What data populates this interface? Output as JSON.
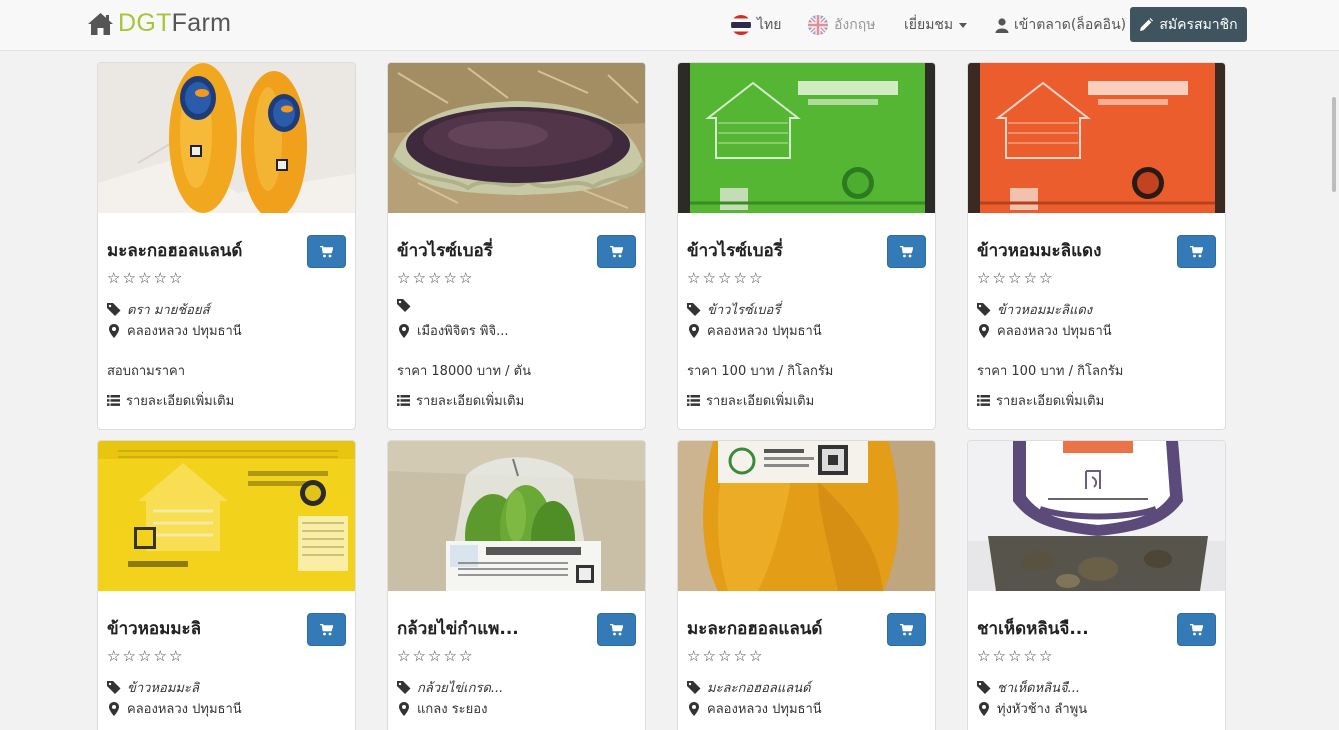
{
  "brand": {
    "part1": "DGT",
    "part2": "Farm"
  },
  "nav": {
    "thai": "ไทย",
    "english": "อังกฤษ",
    "visit": "เยี่ยมชม",
    "login": "เข้าตลาด(ล็อคอิน)",
    "register": "สมัครสมาชิก"
  },
  "colors": {
    "accent": "#337ab7",
    "navbar_button": "#3f545f",
    "brand_green": "#a8c43a"
  },
  "products": [
    {
      "title": "มะละกอฮอลแลนด์",
      "rating": 0,
      "brand": "ตรา มายช้อยส์",
      "location": "คลองหลวง ปทุมธานี",
      "price": "สอบถามราคา",
      "detail": "รายละเอียดเพิ่มเติม",
      "image": "papaya"
    },
    {
      "title": "ข้าวไรซ์เบอรี่",
      "rating": 0,
      "brand": "",
      "location": "เมืองพิจิตร พิจิ...",
      "price": "ราคา 18000 บาท / ตัน",
      "detail": "รายละเอียดเพิ่มเติม",
      "image": "rice-basket"
    },
    {
      "title": "ข้าวไรซ์เบอรี่",
      "rating": 0,
      "brand": "ข้าวไรซ์เบอรี่",
      "location": "คลองหลวง ปทุมธานี",
      "price": "ราคา 100 บาท / กิโลกรัม",
      "detail": "รายละเอียดเพิ่มเติม",
      "image": "rice-bag-green"
    },
    {
      "title": "ข้าวหอมมะลิแดง",
      "rating": 0,
      "brand": "ข้าวหอมมะลิแดง",
      "location": "คลองหลวง ปทุมธานี",
      "price": "ราคา 100 บาท / กิโลกรัม",
      "detail": "รายละเอียดเพิ่มเติม",
      "image": "rice-bag-orange"
    },
    {
      "title": "ข้าวหอมมะลิ",
      "rating": 0,
      "brand": "ข้าวหอมมะลิ",
      "location": "คลองหลวง ปทุมธานี",
      "image": "rice-bag-yellow"
    },
    {
      "title": "กล้วยไข่กำแพ...",
      "rating": 0,
      "brand": "กล้วยไข่เกรด...",
      "location": "แกลง ระยอง",
      "image": "banana"
    },
    {
      "title": "มะละกอฮอลแลนด์",
      "rating": 0,
      "brand": "มะละกอฮอลแลนด์",
      "location": "คลองหลวง ปทุมธานี",
      "image": "papaya-close"
    },
    {
      "title": "ชาเห็ดหลินจื...",
      "rating": 0,
      "brand": "ชาเห็ดหลินจื...",
      "location": "ทุ่งหัวช้าง ลำพูน",
      "image": "mushroom"
    }
  ]
}
